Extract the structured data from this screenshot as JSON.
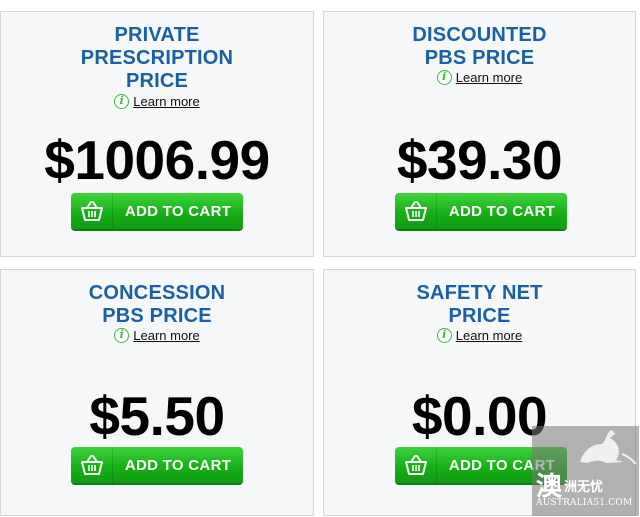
{
  "cards": [
    {
      "title_lines": [
        "PRIVATE",
        "PRESCRIPTION",
        "PRICE"
      ],
      "learn_more": "Learn more",
      "price": "$1006.99",
      "cart_label": "ADD TO CART"
    },
    {
      "title_lines": [
        "DISCOUNTED",
        "PBS PRICE"
      ],
      "learn_more": "Learn more",
      "price": "$39.30",
      "cart_label": "ADD TO CART"
    },
    {
      "title_lines": [
        "CONCESSION",
        "PBS PRICE"
      ],
      "learn_more": "Learn more",
      "price": "$5.50",
      "cart_label": "ADD TO CART"
    },
    {
      "title_lines": [
        "SAFETY NET",
        "PRICE"
      ],
      "learn_more": "Learn more",
      "price": "$0.00",
      "cart_label": "ADD TO CART"
    }
  ],
  "icons": {
    "info": "info-icon",
    "basket": "shopping-basket-icon"
  },
  "colors": {
    "title_blue": "#1b5fa6",
    "cart_green": "#18b018",
    "info_green": "#3fb93f"
  },
  "watermark": {
    "glyph": "澳",
    "text": "洲无忧",
    "url": "AUSTRALIA51.COM"
  }
}
